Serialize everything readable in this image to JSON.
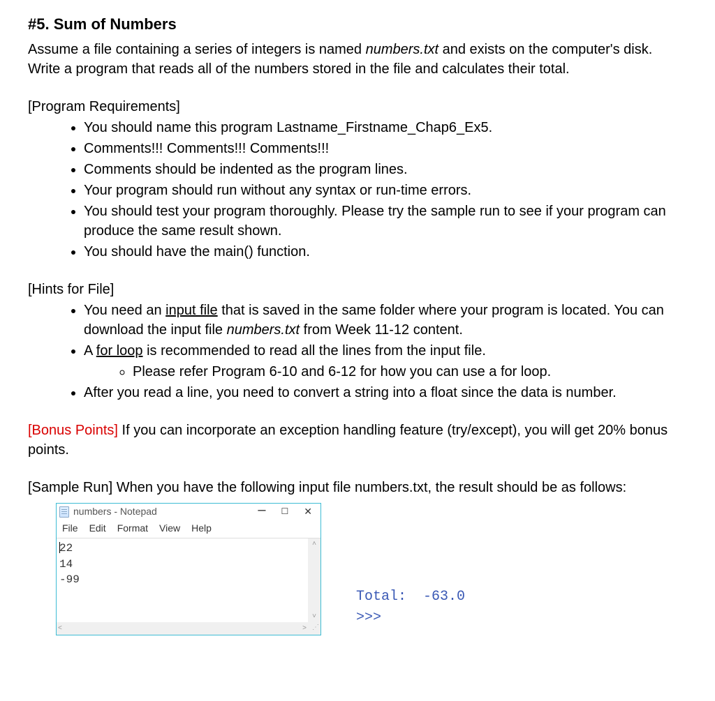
{
  "title": "#5. Sum of Numbers",
  "description_pre": "Assume a file containing a series of integers is named ",
  "description_filename": "numbers.txt",
  "description_post": " and exists on the computer's disk. Write a program that reads all of the numbers stored in the file and calculates their total.",
  "requirements_label": "[Program Requirements]",
  "requirements": [
    "You should name this program Lastname_Firstname_Chap6_Ex5.",
    "Comments!!! Comments!!! Comments!!!",
    "Comments should be indented as the program lines.",
    "Your program should run without any syntax or run-time errors.",
    "You should test your program thoroughly. Please try the sample run to see if your program can produce the same result shown.",
    "You should have the main() function."
  ],
  "hints_label": "[Hints for File]",
  "hint1_pre": "You need an ",
  "hint1_underline": "input file",
  "hint1_mid": " that is saved in the same folder where your program is located. You can download the input file ",
  "hint1_italic": "numbers.txt",
  "hint1_post": " from Week 11-12 content.",
  "hint2_pre": "A ",
  "hint2_underline": "for loop",
  "hint2_post": " is recommended to read all the lines from the input file.",
  "hint2_sub": "Please refer Program 6-10 and 6-12 for how you can use a for loop.",
  "hint3": "After you read a line, you need to convert a string into a float since the data is number.",
  "bonus_label": "[Bonus Points]",
  "bonus_text": "  If you can incorporate an exception handling feature (try/except), you will get 20% bonus points.",
  "sample_label": "[Sample Run]  When you have the following input file numbers.txt, the result should be as follows:",
  "notepad": {
    "title": "numbers - Notepad",
    "menu": {
      "file": "File",
      "edit": "Edit",
      "format": "Format",
      "view": "View",
      "help": "Help"
    },
    "line1": "22",
    "line2": "14",
    "line3": "-99"
  },
  "output": {
    "line1": "Total:  -63.0",
    "prompt": ">>>"
  }
}
